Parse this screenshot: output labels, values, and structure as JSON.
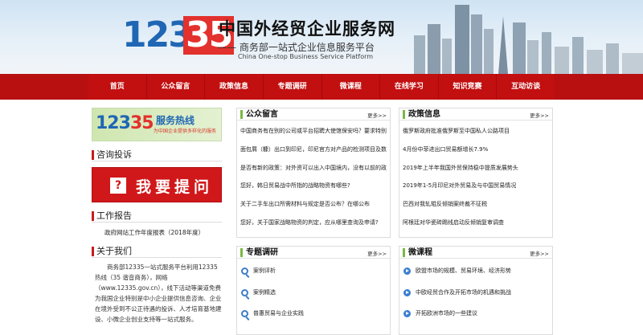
{
  "header": {
    "logo_part1": "123",
    "logo_part2": "35",
    "title": "中国外经贸企业服务网",
    "subtitle": "—— 商务部一站式企业信息服务平台",
    "subtitle_en": "China One-stop Business Service Platform"
  },
  "nav": [
    "首页",
    "公众留言",
    "政策信息",
    "专题调研",
    "微课程",
    "在线学习",
    "知识竞赛",
    "互动访谈"
  ],
  "sidebar": {
    "hotline": {
      "num1": "123",
      "num2": "35",
      "title": "服务热线",
      "sub": "为中国企业提供多样化的服务"
    },
    "consult_title": "咨询投诉",
    "ask_icon": "?",
    "ask_label": "我要提问",
    "report_title": "工作报告",
    "report_link": "政府网站工作年度报表（2018年度）",
    "about_title": "关于我们",
    "about_text": "商务部12335一站式服务平台利用12335热线（35 谐音商务），网络（www.12335.gov.cn），线下活动等渠道免费为我国企业特别是中小企业提供信息咨询、企业在境外受到不公正待遇的投诉、人才培育基地建设、小微企业创业支持等一站式服务。"
  },
  "panels": {
    "messages": {
      "title": "公众留言",
      "more": "更多>>",
      "items": [
        "中国商务有在别的公司或平台招聘大使馆保安吗？要求特别...",
        "面包屑（糠）出口到印尼，印尼官方对产品的检测项目及数...",
        "是否有新的政策：对外资可以出入中国境内，没有以前的政...",
        "您好，韩日贸易战中所指的战略物资有哪些?",
        "关于二手车出口所需材料与规定是否公布？在哪公布",
        "您好，关于国家战略物资的判定，应从哪里查询及申请?"
      ]
    },
    "policy": {
      "title": "政策信息",
      "more": "更多>>",
      "items": [
        "俄罗斯政府批准俄罗斯至中国私人公路项目",
        "4月份中菲进出口贸易额增长7.9%",
        "2019年上半年我国外贸保持稳中提质发展势头",
        "2019年1-5月印尼对外贸易及与中国贸易情况",
        "巴西对我轧辊反倾销案终裁不征税",
        "阿根廷对华瓷砖踢线启动反倾销复审调查"
      ]
    },
    "research": {
      "title": "专题调研",
      "more": "更多>>",
      "items": [
        "案例评析",
        "案例精选",
        "普惠贸易与企业实践"
      ]
    },
    "courses": {
      "title": "微课程",
      "more": "更多>>",
      "items": [
        "欧盟市场的规模、贸易环境、经济形势",
        "中欧经贸合作及开拓市场的机遇和挑战",
        "开拓欧洲市场的一些建议"
      ]
    }
  }
}
